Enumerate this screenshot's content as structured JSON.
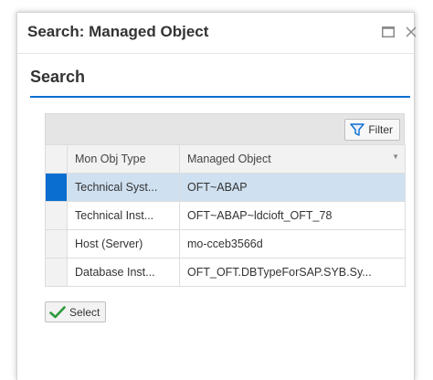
{
  "dialog": {
    "title": "Search: Managed Object",
    "maximize_icon": "maximize-icon",
    "close_icon": "close-icon"
  },
  "section": {
    "title": "Search"
  },
  "toolbar": {
    "filter_label": "Filter",
    "filter_icon": "funnel-icon"
  },
  "table": {
    "columns": [
      "Mon Obj Type",
      "Managed Object"
    ],
    "rows": [
      {
        "type": "Technical Syst...",
        "object": "OFT~ABAP",
        "selected": true
      },
      {
        "type": "Technical Inst...",
        "object": "OFT~ABAP~ldcioft_OFT_78",
        "selected": false
      },
      {
        "type": "Host (Server)",
        "object": "mo-cceb3566d",
        "selected": false
      },
      {
        "type": "Database Inst...",
        "object": "OFT_OFT.DBTypeForSAP.SYB.Sy...",
        "selected": false
      }
    ]
  },
  "actions": {
    "select_label": "Select",
    "select_icon": "checkmark-icon"
  },
  "colors": {
    "accent": "#0a6ed1",
    "selected_row": "#cfe0f0",
    "check_green": "#2b9a3b"
  }
}
